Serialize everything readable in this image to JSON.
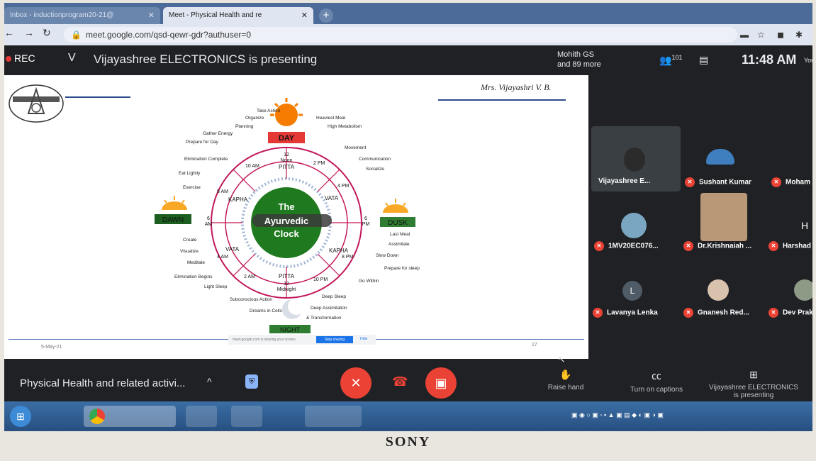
{
  "browser": {
    "tabs": [
      {
        "label": "Inbox - inductionprogram20-21@"
      },
      {
        "label": "Meet - Physical Health and re"
      }
    ],
    "url": "meet.google.com/qsd-qewr-gdr?authuser=0"
  },
  "meet_header": {
    "rec_label": "REC",
    "presenter_initial": "V",
    "presenting_text": "Vijayashree ELECTRONICS is presenting",
    "participants_preview": "Mohith GS",
    "participants_more": "and 89 more",
    "people_count": "101",
    "time": "11:48 AM",
    "you_label": "You"
  },
  "slide": {
    "author": "Mrs. Vijayashri V. B.",
    "date": "5-May-21",
    "page_number": "27",
    "share_notice": "meet.google.com is sharing your screen.",
    "stop_sharing": "Stop sharing",
    "hide": "Hide",
    "clock": {
      "title_line1": "The",
      "title_line2": "Ayurvedic",
      "title_line3": "Clock",
      "quadrants": {
        "day": "DAY",
        "dawn": "DAWN",
        "dusk": "DUSK",
        "night": "NIGHT"
      },
      "times": {
        "noon": "12",
        "noon_label": "Noon",
        "midnight": "12",
        "midnight_label": "Midnight",
        "t6am": "6",
        "t6am_label": "AM",
        "t6pm": "6",
        "t6pm_label": "PM",
        "t10am": "10 AM",
        "t2pm": "2 PM",
        "t4pm": "4 PM",
        "t8pm": "8 PM",
        "t10pm": "10 PM",
        "t2am": "2 AM",
        "t4am": "4 AM",
        "t8am": "8 AM"
      },
      "doshas": {
        "pitta_top": "PITTA",
        "pitta_bottom": "PITTA",
        "vata_right": "VATA",
        "vata_left": "VATA",
        "kapha_left": "KAPHA",
        "kapha_right": "KAPHA"
      },
      "activities": {
        "top_left": [
          "Take Action",
          "Organize",
          "Planning",
          "Gather Energy",
          "Prepare for Day"
        ],
        "top_right": [
          "Heaviest Meal",
          "High Metabolism",
          "Movement",
          "Communication",
          "Socialize"
        ],
        "left": [
          "Elimination Complete",
          "Eat Lightly",
          "Exercise"
        ],
        "bottom_left": [
          "Create",
          "Visualize",
          "Meditate",
          "Elimination Begins",
          "Light Sleep"
        ],
        "bottom_center": [
          "Subconscious Action",
          "Dreams in Cells"
        ],
        "right": [
          "Last Meal",
          "Assimilate",
          "Slow Down",
          "Prepare for sleep",
          "Go Within"
        ],
        "bottom_right": [
          "Deep Sleep",
          "Deep Assimilation",
          "& Transformation"
        ]
      }
    }
  },
  "participants": [
    {
      "name": "Vijayashree E..."
    },
    {
      "name": "Sushant Kumar"
    },
    {
      "name": "Moham"
    },
    {
      "name": "1MV20EC076..."
    },
    {
      "name": "Dr.Krishnaiah ..."
    },
    {
      "name": "Harshad"
    },
    {
      "name": "Lavanya Lenka",
      "initial": "L"
    },
    {
      "name": "Gnanesh Red..."
    },
    {
      "name": "Dev Prak"
    },
    {
      "initial": "H"
    }
  ],
  "bottom_bar": {
    "meeting_name": "Physical Health and related activi...",
    "raise_hand": "Raise hand",
    "captions": "Turn on captions",
    "presenting_line1": "Vijayashree ELECTRONICS",
    "presenting_line2": "is presenting"
  },
  "monitor_brand": "SONY",
  "colors": {
    "accent_red": "#ea4335",
    "meet_bg": "#202124",
    "day_label": "#e53935",
    "dawn_label": "#1b5e20",
    "clock_green": "#2e7d32"
  }
}
